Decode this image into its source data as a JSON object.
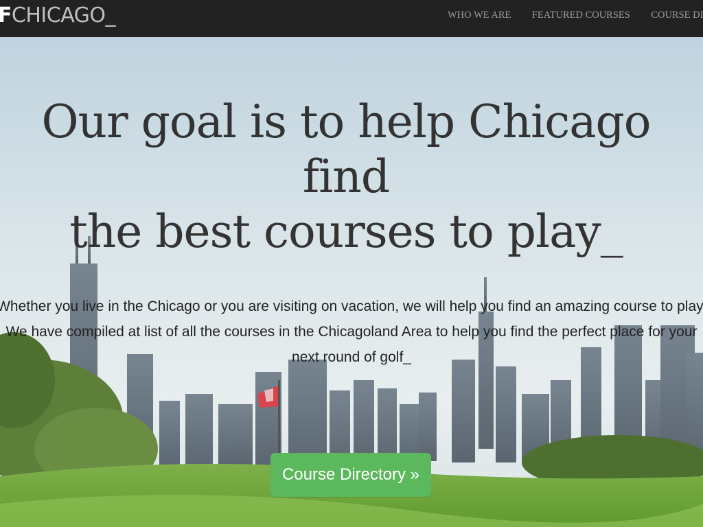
{
  "navbar": {
    "brand_prefix": ".F",
    "brand_main": "CHICAGO_",
    "links": [
      "WHO WE ARE",
      "FEATURED COURSES",
      "COURSE DIR"
    ]
  },
  "hero": {
    "headline_line1": "Our goal is to help Chicago find",
    "headline_line2": "the best courses to play_",
    "lead_line1": "Whether you live in the Chicago or you are visiting on vacation, we will help you find an amazing course to play.",
    "lead_line2": "We have compiled at list of all the courses in the Chicagoland Area to help you find the perfect place for your",
    "lead_line3": "next round of golf_",
    "cta_label": "Course Directory »"
  },
  "colors": {
    "navbar_bg": "#222222",
    "cta_bg": "#5cb85c",
    "headline": "#333333"
  }
}
